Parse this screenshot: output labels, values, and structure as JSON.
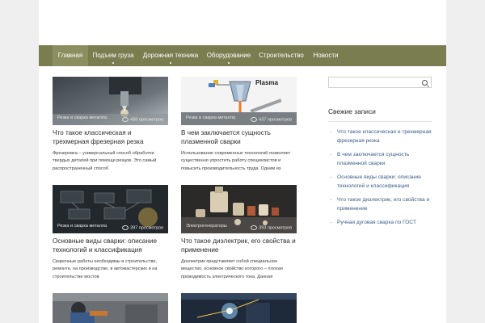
{
  "nav": {
    "items": [
      {
        "label": "Главная",
        "active": true,
        "dropdown": false
      },
      {
        "label": "Подъем груза",
        "active": false,
        "dropdown": true
      },
      {
        "label": "Дорожная техника",
        "active": false,
        "dropdown": true
      },
      {
        "label": "Оборудование",
        "active": false,
        "dropdown": true
      },
      {
        "label": "Строительство",
        "active": false,
        "dropdown": false
      },
      {
        "label": "Новости",
        "active": false,
        "dropdown": false
      }
    ],
    "colors": {
      "bar": "#7a7d50",
      "active": "#8b8e5e"
    }
  },
  "posts": [
    {
      "category": "Резка и сварка металла",
      "views": "456 просмотров",
      "title": "Что такое классическая и трехмерная фрезерная резка",
      "excerpt": "Фрезеровка – универсальный способ обработки твердых деталей при помощи резцов. Это самый распространенный способ",
      "image": "milling-machine"
    },
    {
      "category": "Резка и сварка металла",
      "views": "437 просмотров",
      "title": "В чем заключается сущность плазменной сварки",
      "excerpt": "Использование современных технологий позволяет существенно упростить работу специалистов и повысить производительность труда. Одним из",
      "image": "plasma-diagram",
      "image_text": "Plasma"
    },
    {
      "category": "Резка и сварка металла",
      "views": "397 просмотров",
      "title": "Основные виды сварки: описание технологий и классификация",
      "excerpt": "Сварочные работы необходимы в строительстве, ремонте, на производстве, в автомастерских и на строительстве мостов",
      "image": "welding-types"
    },
    {
      "category": "Электрогенераторы",
      "views": "393 просмотров",
      "title": "Что такое диэлектрик, его свойства и применение",
      "excerpt": "Диэлектрик представляет собой специальное вещество, основное свойство которого – плохая проводимость электрического тока. Данная",
      "image": "dielectric-parts"
    },
    {
      "category": "",
      "views": "",
      "title": "",
      "excerpt": "",
      "image": "welder-photo"
    },
    {
      "category": "",
      "views": "",
      "title": "",
      "excerpt": "",
      "image": "welding-sparks"
    }
  ],
  "sidebar": {
    "search": {
      "placeholder": "",
      "value": ""
    },
    "recent_title": "Свежие записи",
    "recent": [
      "Что такое классическая и трехмерная фрезерная резка",
      "В чем заключается сущность плазменной сварки",
      "Основные виды сварки: описание технологий и классификация",
      "Что такое диэлектрик, его свойства и применение",
      "Ручная дуговая сварка по ГОСТ"
    ]
  }
}
